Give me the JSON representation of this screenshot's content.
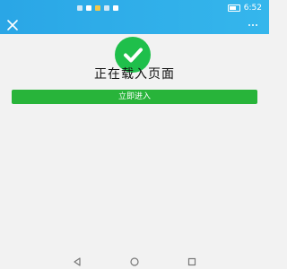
{
  "status_bar": {
    "time": "6:52"
  },
  "nav": {
    "close_icon": "close-icon",
    "more_icon": "more-dots-icon"
  },
  "main": {
    "title": "正在载入页面",
    "enter_button_label": "立即进入",
    "success_icon": "check-icon"
  },
  "system_nav": {
    "back_icon": "triangle-back-icon",
    "home_icon": "circle-home-icon",
    "recents_icon": "square-recents-icon"
  },
  "colors": {
    "accent_blue": "#2aa6e6",
    "success_green": "#1fbf4b",
    "button_green": "#28b43a",
    "background": "#f2f2f2"
  }
}
